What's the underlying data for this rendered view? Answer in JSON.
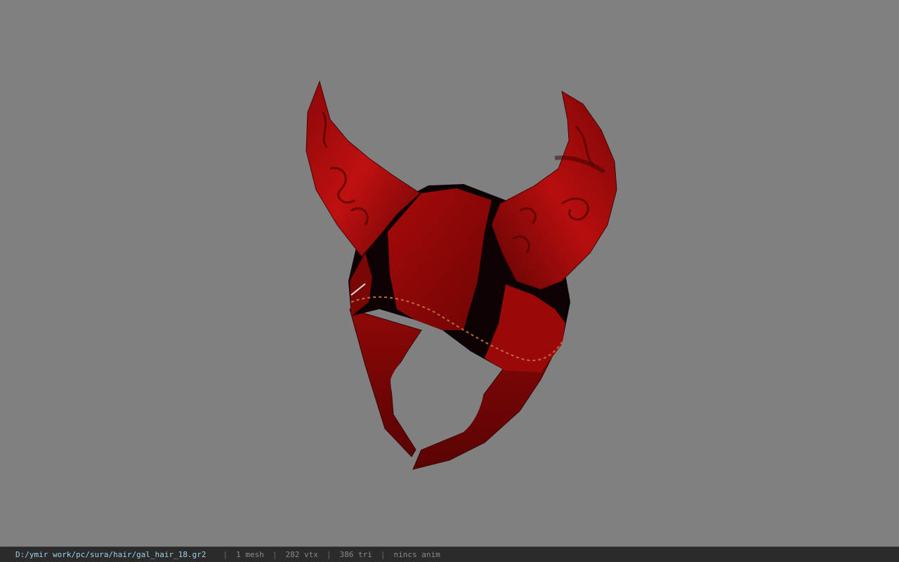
{
  "viewer": {
    "background_color": "#808080",
    "model_primary_color": "#b00a0a",
    "model_secondary_color": "#0c0203"
  },
  "status_bar": {
    "file_path": "D:/ymir work/pc/sura/hair/gal_hair_18.gr2",
    "separator": "|",
    "mesh_count": "1 mesh",
    "vertex_count": "282 vtx",
    "triangle_count": "386 tri",
    "anim_status": "nincs anim"
  }
}
